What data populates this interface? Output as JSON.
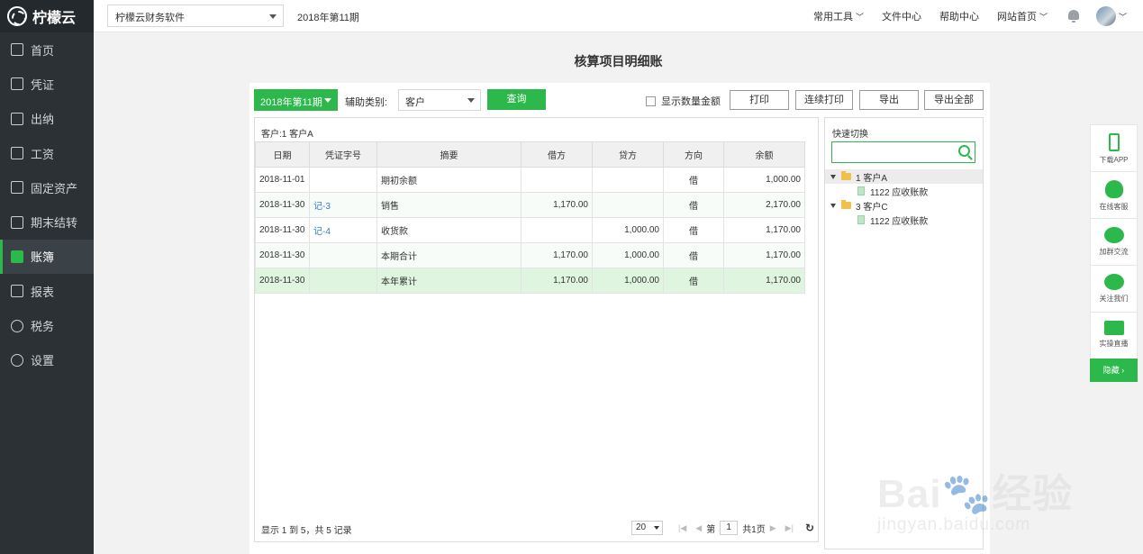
{
  "app": {
    "name": "柠檬云"
  },
  "sidebar": {
    "items": [
      {
        "label": "首页",
        "icon": "home-icon"
      },
      {
        "label": "凭证",
        "icon": "voucher-icon"
      },
      {
        "label": "出纳",
        "icon": "cashier-icon"
      },
      {
        "label": "工资",
        "icon": "salary-icon"
      },
      {
        "label": "固定资产",
        "icon": "asset-icon"
      },
      {
        "label": "期末结转",
        "icon": "calendar-icon"
      },
      {
        "label": "账簿",
        "icon": "ledger-book-icon",
        "active": true
      },
      {
        "label": "报表",
        "icon": "chart-icon"
      },
      {
        "label": "税务",
        "icon": "tax-icon"
      },
      {
        "label": "设置",
        "icon": "gear-icon"
      }
    ]
  },
  "topbar": {
    "company": "柠檬云财务软件",
    "period": "2018年第11期",
    "links": [
      "常用工具",
      "文件中心",
      "帮助中心",
      "网站首页"
    ]
  },
  "page": {
    "title": "核算项目明细账"
  },
  "toolbar": {
    "period_button": "2018年第11期",
    "aux_label": "辅助类别:",
    "aux_value": "客户",
    "query": "查询",
    "show_qty": "显示数量金额",
    "print": "打印",
    "batch_print": "连续打印",
    "export": "导出",
    "export_all": "导出全部"
  },
  "table": {
    "caption": "客户:1 客户A",
    "headers": [
      "日期",
      "凭证字号",
      "摘要",
      "借方",
      "贷方",
      "方向",
      "余额"
    ],
    "rows": [
      {
        "date": "2018-11-01",
        "voucher": "",
        "summary": "期初余额",
        "debit": "",
        "credit": "",
        "direction": "借",
        "balance": "1,000.00"
      },
      {
        "date": "2018-11-30",
        "voucher": "记-3",
        "summary": "销售",
        "debit": "1,170.00",
        "credit": "",
        "direction": "借",
        "balance": "2,170.00"
      },
      {
        "date": "2018-11-30",
        "voucher": "记-4",
        "summary": "收货款",
        "debit": "",
        "credit": "1,000.00",
        "direction": "借",
        "balance": "1,170.00"
      },
      {
        "date": "2018-11-30",
        "voucher": "",
        "summary": "本期合计",
        "debit": "1,170.00",
        "credit": "1,000.00",
        "direction": "借",
        "balance": "1,170.00"
      },
      {
        "date": "2018-11-30",
        "voucher": "",
        "summary": "本年累计",
        "debit": "1,170.00",
        "credit": "1,000.00",
        "direction": "借",
        "balance": "1,170.00"
      }
    ],
    "footer": "显示 1 到 5，共 5 记录",
    "pager": {
      "page_size": "20",
      "page_label": "第",
      "page": "1",
      "total": "共1页"
    }
  },
  "quick_switch": {
    "title": "快速切换",
    "tree": [
      {
        "label": "1 客户A",
        "children": [
          "1122 应收账款"
        ]
      },
      {
        "label": "3 客户C",
        "children": [
          "1122 应收账款"
        ]
      }
    ]
  },
  "float_bar": {
    "items": [
      "下载APP",
      "在线客服",
      "加群交流",
      "关注我们",
      "实操直播"
    ],
    "hide": "隐藏 ›"
  },
  "watermark": {
    "brand": "Bai",
    "brand2": "经验",
    "url": "jingyan.baidu.com"
  },
  "colors": {
    "accent": "#2db84c",
    "sidebar": "#2b3135",
    "link": "#3a7bd5"
  }
}
